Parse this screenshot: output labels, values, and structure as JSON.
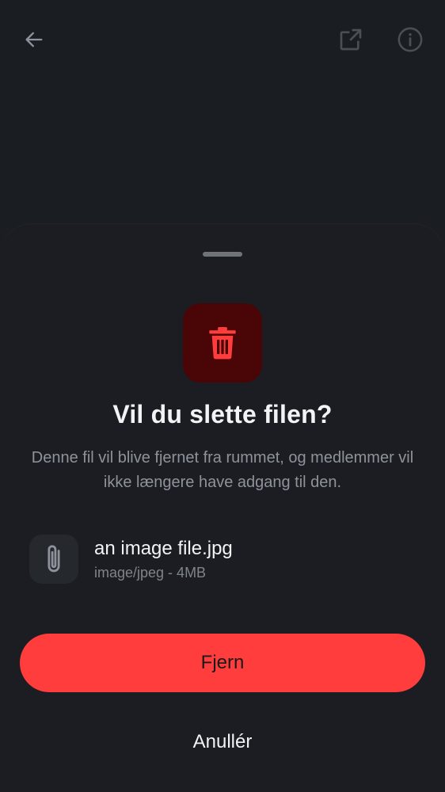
{
  "header": {
    "back_icon": "arrow-left-icon",
    "open_icon": "open-external-icon",
    "info_icon": "info-icon"
  },
  "dialog": {
    "icon": "trash-icon",
    "title": "Vil du slette filen?",
    "description": "Denne fil vil blive fjernet fra rummet, og medlemmer vil ikke længere have adgang til den.",
    "file": {
      "icon": "paperclip-icon",
      "name": "an image file.jpg",
      "meta": "image/jpeg - 4MB"
    },
    "confirm_label": "Fjern",
    "cancel_label": "Anullér"
  },
  "colors": {
    "background": "#1a1d22",
    "danger": "#ff3d3d",
    "danger_bg": "#4a0506",
    "text_primary": "#f2f3f5",
    "text_secondary": "#8e939b"
  }
}
